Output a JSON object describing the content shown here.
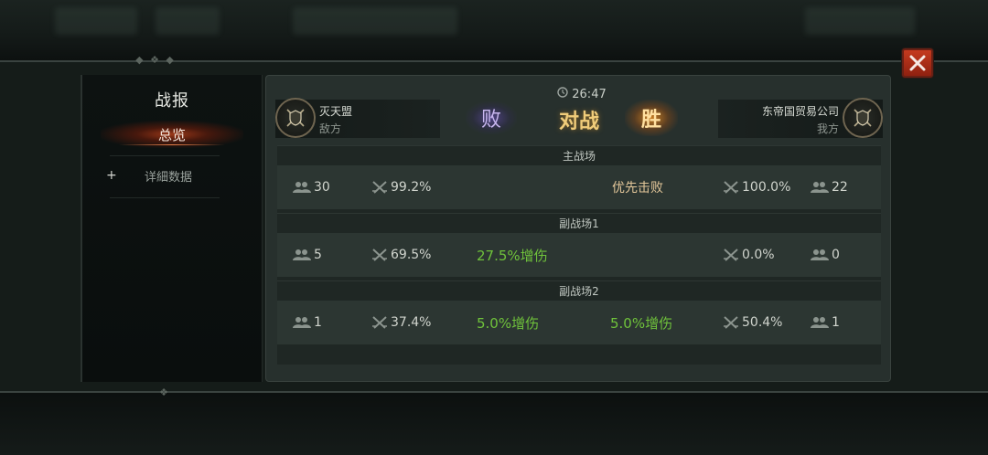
{
  "sidebar": {
    "title": "战报",
    "items": [
      {
        "label": "总览",
        "active": true
      },
      {
        "label": "详細数据",
        "prefix": "+"
      }
    ]
  },
  "header": {
    "timer": "26:47",
    "vs_label": "对战",
    "left_team": {
      "name": "灭天盟",
      "side": "敌方",
      "result": "败"
    },
    "right_team": {
      "name": "东帝国贸易公司",
      "side": "我方",
      "result": "胜"
    }
  },
  "battles": [
    {
      "title": "主战场",
      "left": {
        "players": "30",
        "rate": "99.2%",
        "effect": ""
      },
      "center_text": "优先击败",
      "right": {
        "effect": "",
        "rate": "100.0%",
        "players": "22"
      }
    },
    {
      "title": "副战场1",
      "left": {
        "players": "5",
        "rate": "69.5%",
        "effect": "27.5%增伤"
      },
      "center_text": "",
      "right": {
        "effect": "",
        "rate": "0.0%",
        "players": "0"
      }
    },
    {
      "title": "副战场2",
      "left": {
        "players": "1",
        "rate": "37.4%",
        "effect": "5.0%增伤"
      },
      "center_text": "",
      "right": {
        "effect": "5.0%增伤",
        "rate": "50.4%",
        "players": "1"
      }
    }
  ],
  "colors": {
    "accent_win": "#f0a030",
    "accent_lose": "#8a70d8",
    "buff_green": "#6fc23b",
    "close_red": "#c43a1f"
  },
  "icons": {
    "players": "players-icon",
    "swords": "crossed-swords-icon",
    "close": "close-icon",
    "timer": "clock-icon",
    "emblem": "shield-emblem-icon"
  }
}
